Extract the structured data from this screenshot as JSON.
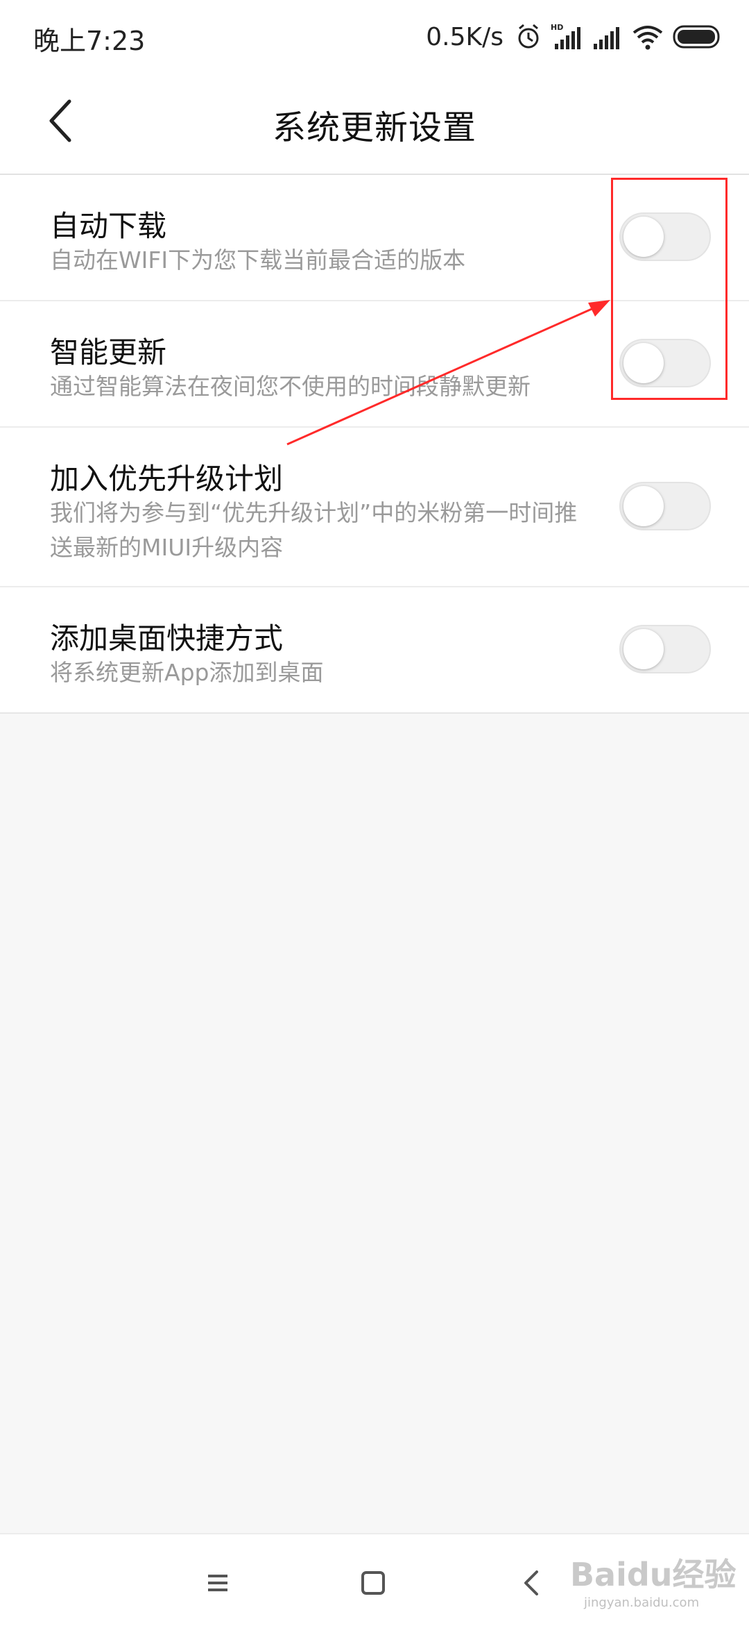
{
  "status_bar": {
    "time": "晚上7:23",
    "net_speed": "0.5K/s",
    "icons": [
      "alarm-icon",
      "hd-signal-icon",
      "signal-icon",
      "wifi-icon",
      "battery-icon"
    ]
  },
  "header": {
    "back_icon": "chevron-left-icon",
    "title": "系统更新设置"
  },
  "settings": [
    {
      "title": "自动下载",
      "subtitle": "自动在WIFI下为您下载当前最合适的版本",
      "enabled": false
    },
    {
      "title": "智能更新",
      "subtitle": "通过智能算法在夜间您不使用的时间段静默更新",
      "enabled": false
    },
    {
      "title": "加入优先升级计划",
      "subtitle": "我们将为参与到“优先升级计划”中的米粉第一时间推送最新的MIUI升级内容",
      "enabled": false
    },
    {
      "title": "添加桌面快捷方式",
      "subtitle": "将系统更新App添加到桌面",
      "enabled": false
    }
  ],
  "nav_bar": {
    "icons": [
      "menu-icon",
      "home-icon",
      "back-icon"
    ]
  },
  "watermark": {
    "text": "Baidu经验",
    "sub": "jingyan.baidu.com"
  },
  "colors": {
    "annotation": "#ff2a2a",
    "toggle_off": "#efefef",
    "subtitle": "#9a9a9a"
  }
}
